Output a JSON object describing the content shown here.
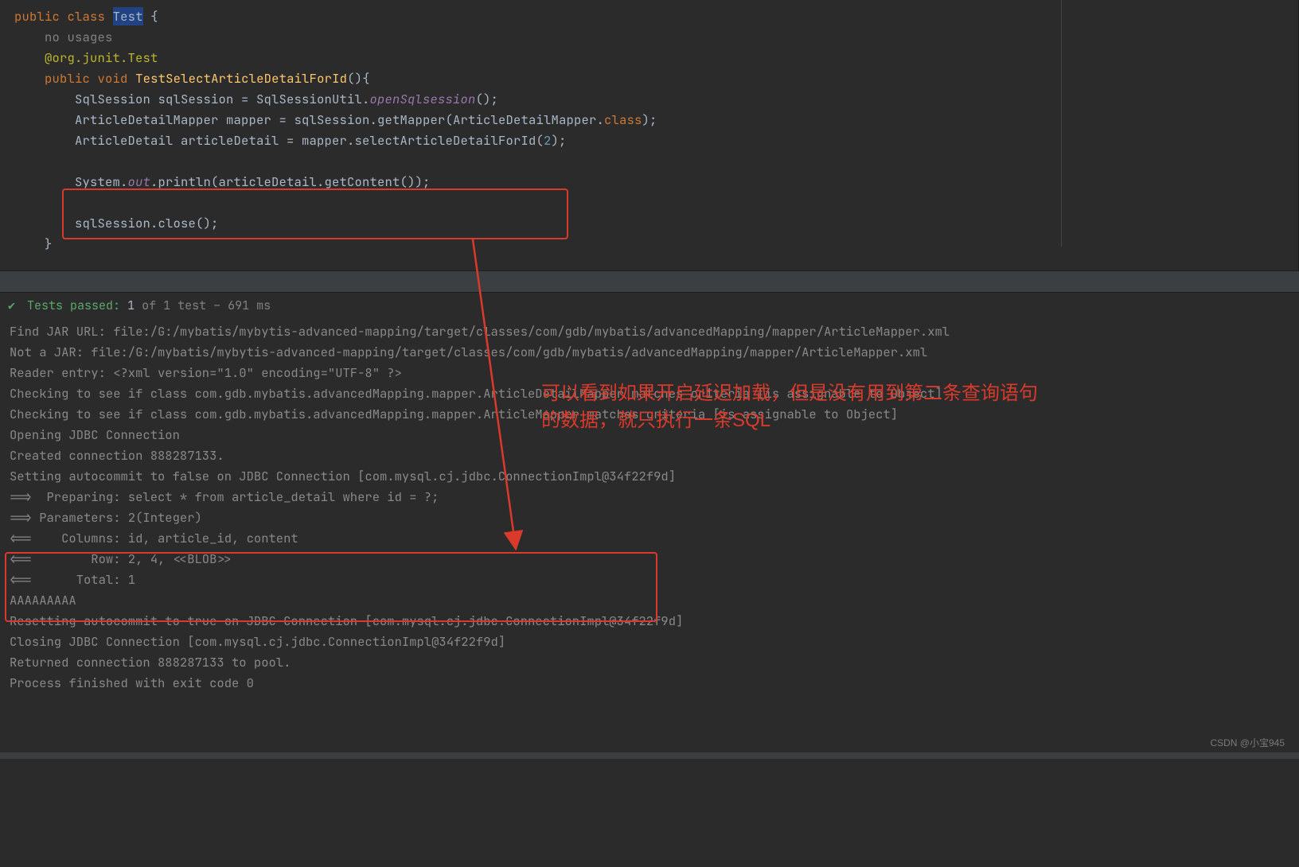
{
  "code": {
    "l1": {
      "kw1": "public",
      "kw2": "class",
      "cls": "Test",
      "brace": " {"
    },
    "l2": {
      "meta": "no usages"
    },
    "l3": {
      "anno": "@org.junit.",
      "anno2": "Test"
    },
    "l4": {
      "kw1": "public",
      "kw2": "void",
      "name": "TestSelectArticleDetailForId",
      "tail": "(){"
    },
    "l5": {
      "a": "SqlSession sqlSession = SqlSessionUtil.",
      "m": "openSqlsession",
      "t": "();"
    },
    "l6": {
      "a": "ArticleDetailMapper mapper = sqlSession.getMapper(ArticleDetailMapper.",
      "k": "class",
      "t": ");"
    },
    "l7": {
      "a": "ArticleDetail articleDetail = mapper.selectArticleDetailForId(",
      "n": "2",
      "t": ");"
    },
    "l8": {
      "a": "System.",
      "s": "out",
      "b": ".println(articleDetail.getContent());"
    },
    "l9": {
      "a": "sqlSession.close();"
    },
    "l10": {
      "a": "}"
    }
  },
  "test_status": {
    "label": "Tests passed:",
    "count": "1",
    "of": " of 1 test – ",
    "time": "691 ms"
  },
  "console": [
    "Find JAR URL: file:/G:/mybatis/mybytis-advanced-mapping/target/classes/com/gdb/mybatis/advancedMapping/mapper/ArticleMapper.xml",
    "Not a JAR: file:/G:/mybatis/mybytis-advanced-mapping/target/classes/com/gdb/mybatis/advancedMapping/mapper/ArticleMapper.xml",
    "Reader entry: <?xml version=\"1.0\" encoding=\"UTF-8\" ?>",
    "Checking to see if class com.gdb.mybatis.advancedMapping.mapper.ArticleDetailMapper matches criteria [is assignable to Object]",
    "Checking to see if class com.gdb.mybatis.advancedMapping.mapper.ArticleMapper matches criteria [is assignable to Object]",
    "Opening JDBC Connection",
    "Created connection 888287133.",
    "Setting autocommit to false on JDBC Connection [com.mysql.cj.jdbc.ConnectionImpl@34f22f9d]",
    "==>  Preparing: select * from article_detail where id = ?;",
    "==> Parameters: 2(Integer)",
    "<==    Columns: id, article_id, content",
    "<==        Row: 2, 4, <<BLOB>>",
    "<==      Total: 1",
    "AAAAAAAAA",
    "Resetting autocommit to true on JDBC Connection [com.mysql.cj.jdbc.ConnectionImpl@34f22f9d]",
    "Closing JDBC Connection [com.mysql.cj.jdbc.ConnectionImpl@34f22f9d]",
    "Returned connection 888287133 to pool.",
    "",
    "Process finished with exit code 0"
  ],
  "annotation": {
    "line1": "可以看到如果开启延迟加载，但是没有用到第二条查询语句",
    "line2": "的数据，就只执行一条SQL"
  },
  "watermark": "CSDN @小宝945"
}
